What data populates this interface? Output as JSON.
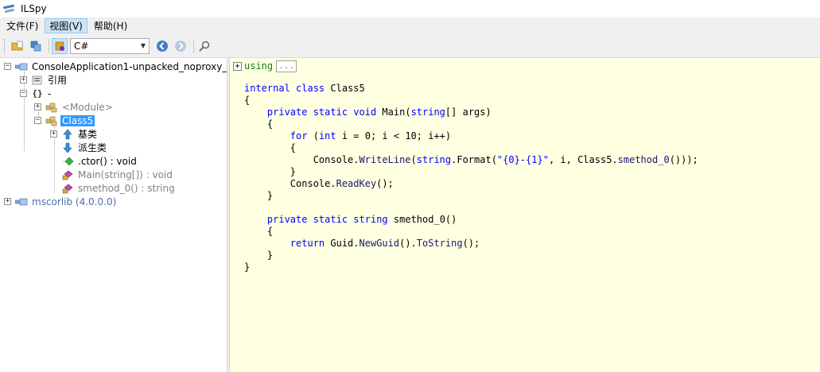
{
  "window": {
    "title": "ILSpy"
  },
  "menu": {
    "items": [
      "文件(F)",
      "视图(V)",
      "帮助(H)"
    ],
    "active_index": 1
  },
  "toolbar": {
    "language": "C#"
  },
  "tree": {
    "assembly_label": "ConsoleApplication1-unpacked_noproxy_",
    "references_label": "引用",
    "namespace_label": "-",
    "module_label": "<Module>",
    "class_label": "Class5",
    "base_types_label": "基类",
    "derived_types_label": "派生类",
    "ctor_label": ".ctor() : void",
    "main_label": "Main(string[]) : void",
    "smethod_label": "smethod_0() : string",
    "mscorlib_label": "mscorlib (4.0.0.0)"
  },
  "code": {
    "using_keyword": "using",
    "using_collapsed": "...",
    "class_keywords": "internal class",
    "class_name": "Class5",
    "main_modifiers": "private static void",
    "main_name": "Main",
    "main_param_type": "string",
    "main_params_rest": "[] args)",
    "for_keyword": "for",
    "int_keyword": "int",
    "for_rest": " i = 0; i < 10; i++)",
    "console_id": "Console.",
    "writeline": "WriteLine",
    "string_type": "string",
    "format_call": ".Format(",
    "format_literal": "\"{0}-{1}\"",
    "writeline_rest": ", i, Class5.",
    "smethod_call": "smethod_0",
    "writeline_end": "()));",
    "readkey_id": "Console.",
    "readkey": "ReadKey",
    "readkey_end": "();",
    "smethod_modifiers": "private static",
    "smethod_return_type": "string",
    "smethod_name": "smethod_0",
    "smethod_sig_end": "()",
    "return_keyword": "return",
    "guid_id": " Guid.",
    "newguid": "NewGuid",
    "tostring_dot": "().",
    "tostring": "ToString",
    "return_end": "();"
  }
}
